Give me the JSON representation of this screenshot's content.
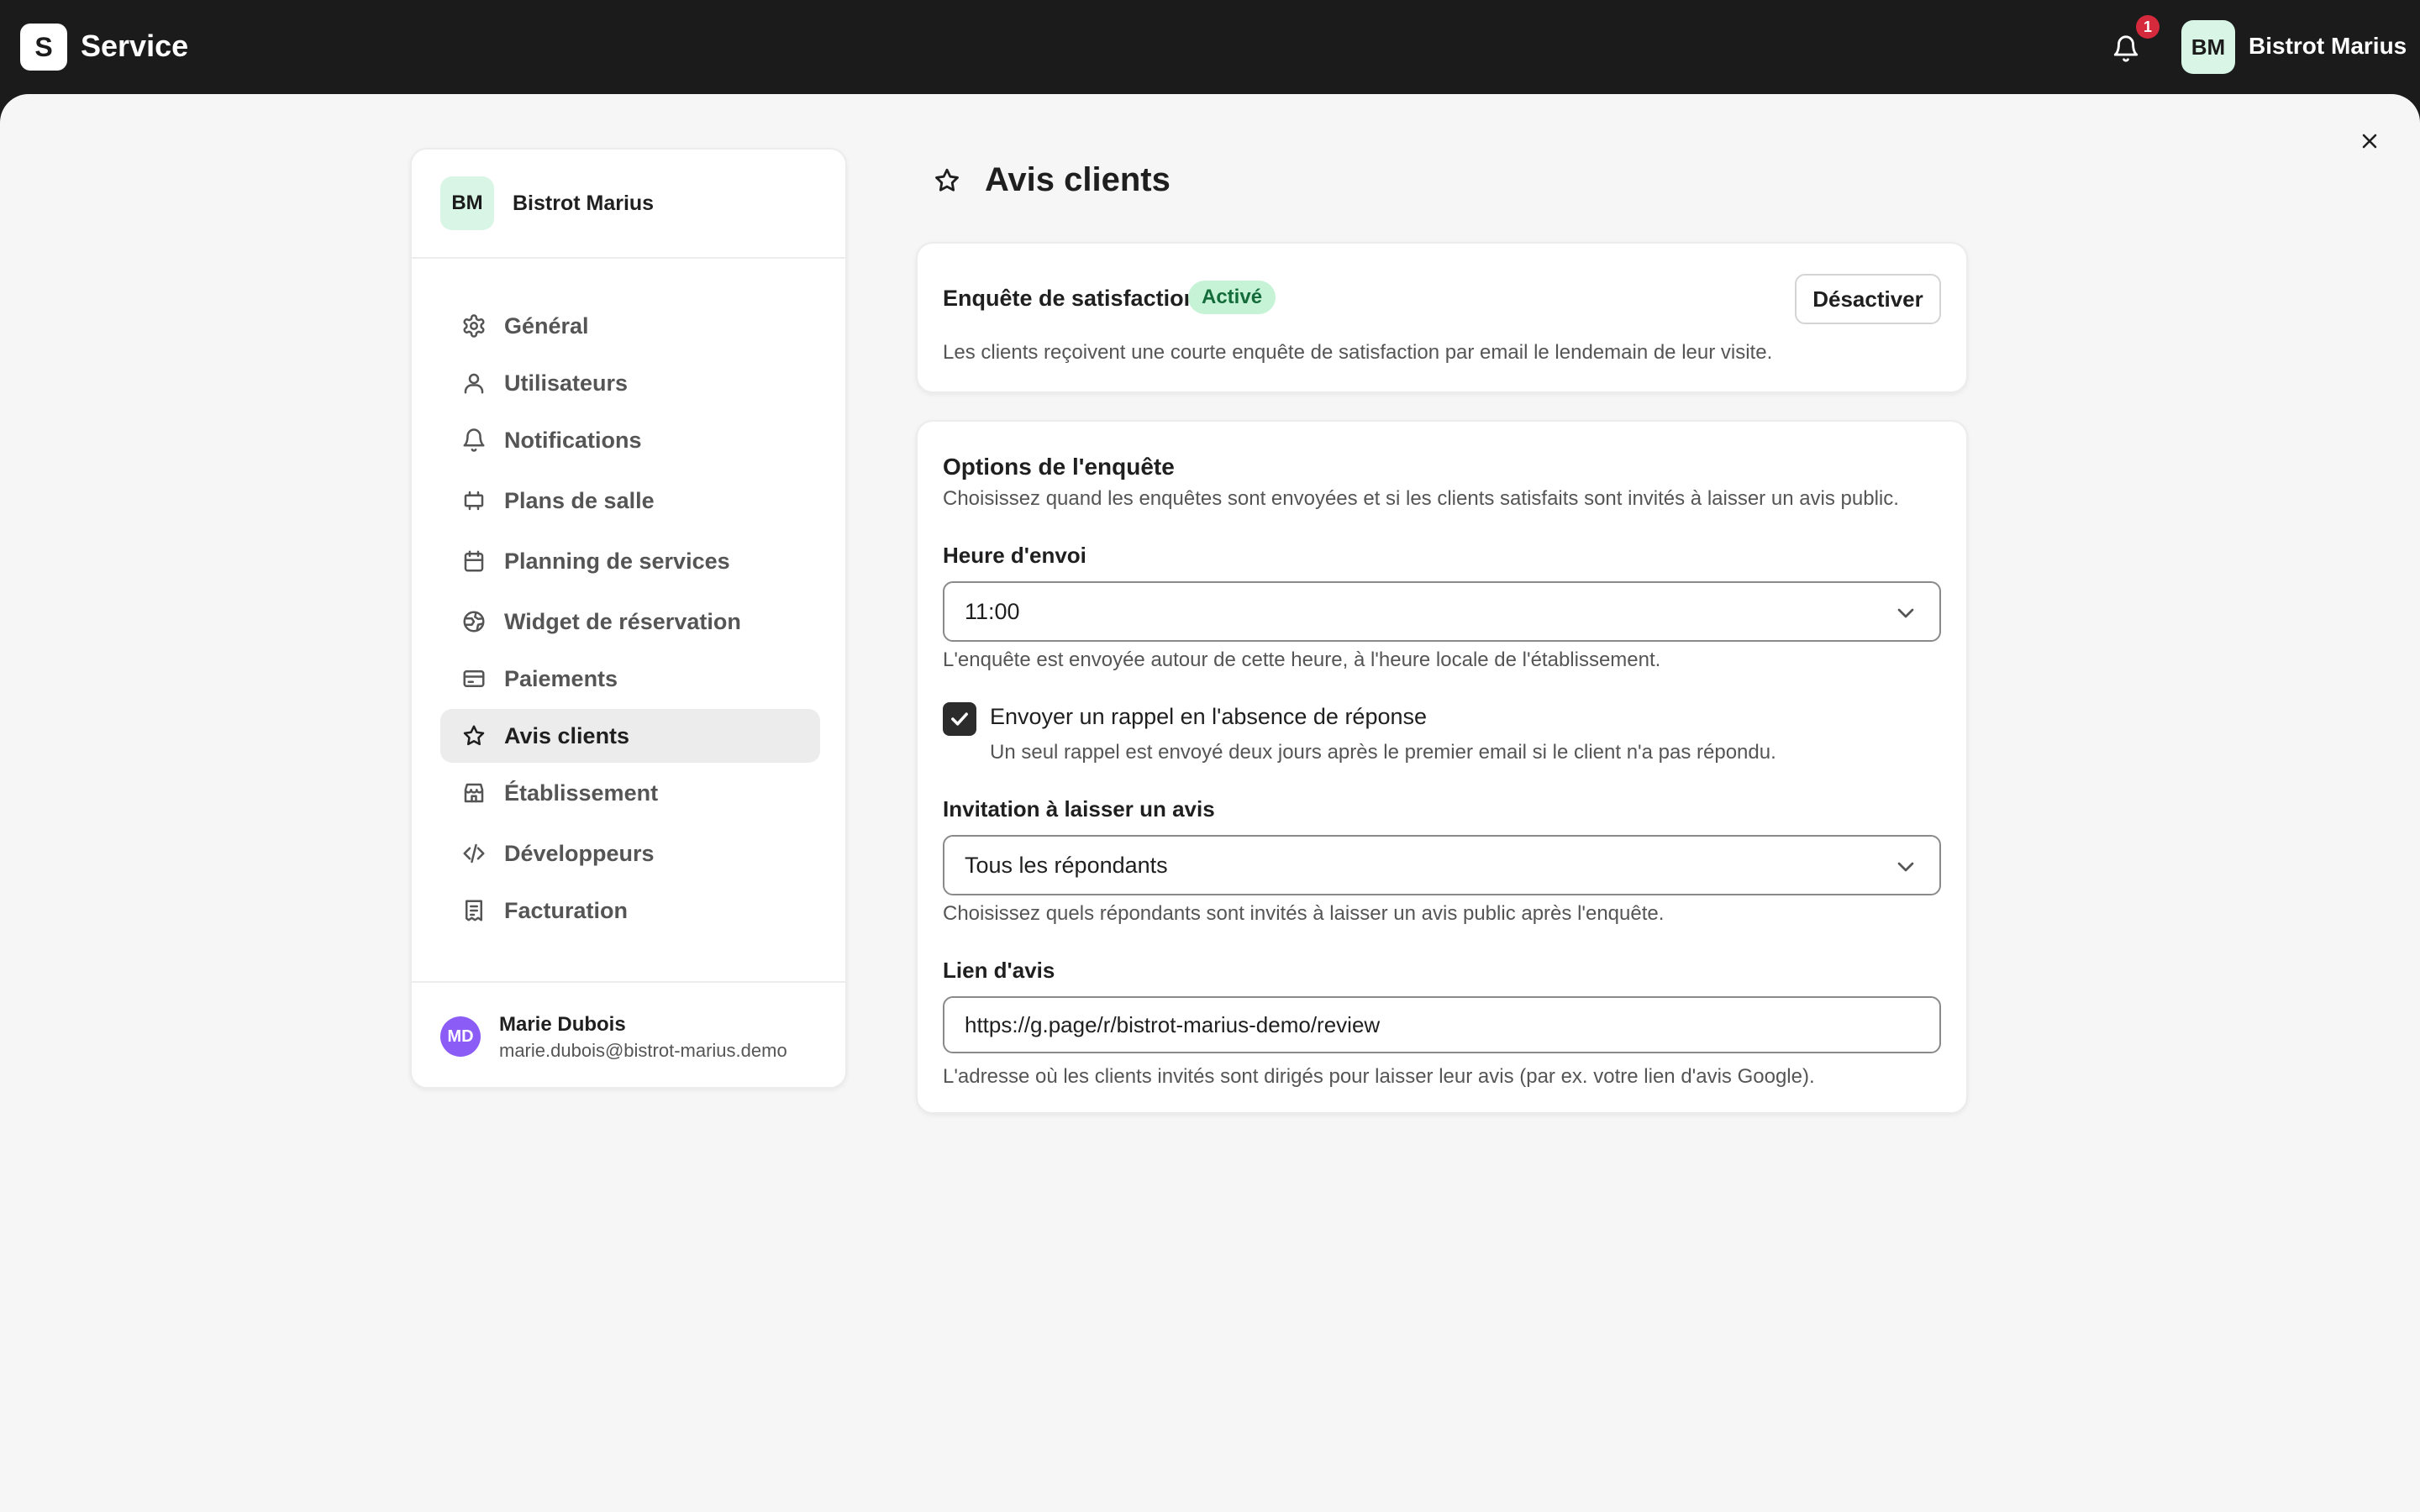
{
  "topbar": {
    "logo_letter": "S",
    "app_name": "Service",
    "notification_count": "1",
    "avatar_initials": "BM",
    "user_name": "Bistrot Marius"
  },
  "sidebar": {
    "org_initials": "BM",
    "org_name": "Bistrot Marius",
    "items": [
      {
        "label": "Général",
        "icon": "gear-icon"
      },
      {
        "label": "Utilisateurs",
        "icon": "user-icon"
      },
      {
        "label": "Notifications",
        "icon": "bell-icon"
      },
      {
        "label": "Plans de salle",
        "icon": "floor-plan-icon"
      },
      {
        "label": "Planning de services",
        "icon": "calendar-icon"
      },
      {
        "label": "Widget de réservation",
        "icon": "globe-icon"
      },
      {
        "label": "Paiements",
        "icon": "credit-card-icon"
      },
      {
        "label": "Avis clients",
        "icon": "star-icon"
      },
      {
        "label": "Établissement",
        "icon": "store-icon"
      },
      {
        "label": "Développeurs",
        "icon": "code-icon"
      },
      {
        "label": "Facturation",
        "icon": "receipt-icon"
      }
    ],
    "active_item": "Avis clients",
    "footer": {
      "initials": "MD",
      "name": "Marie Dubois",
      "email": "marie.dubois@bistrot-marius.demo"
    }
  },
  "page": {
    "title": "Avis clients"
  },
  "survey_card": {
    "title": "Enquête de satisfaction",
    "status": "Activé",
    "action_label": "Désactiver",
    "description": "Les clients reçoivent une courte enquête de satisfaction par email le lendemain de leur visite."
  },
  "options_card": {
    "title": "Options de l'enquête",
    "description": "Choisissez quand les enquêtes sont envoyées et si les clients satisfaits sont invités à laisser un avis public.",
    "send_time": {
      "label": "Heure d'envoi",
      "value": "11:00",
      "hint": "L'enquête est envoyée autour de cette heure, à l'heure locale de l'établissement."
    },
    "reminder": {
      "checked": true,
      "label": "Envoyer un rappel en l'absence de réponse",
      "hint": "Un seul rappel est envoyé deux jours après le premier email si le client n'a pas répondu."
    },
    "invitation": {
      "label": "Invitation à laisser un avis",
      "value": "Tous les répondants",
      "hint": "Choisissez quels répondants sont invités à laisser un avis public après l'enquête."
    },
    "review_link": {
      "label": "Lien d'avis",
      "value": "https://g.page/r/bistrot-marius-demo/review",
      "hint": "L'adresse où les clients invités sont dirigés pour laisser leur avis (par ex. votre lien d'avis Google)."
    }
  },
  "colors": {
    "topbar": "#1b1b1b",
    "background": "#f6f6f6",
    "active_badge_bg": "#c6f3d6",
    "active_badge_text": "#146c3b",
    "notification_badge": "#d42a3c",
    "footer_avatar": "#8b5cf6"
  }
}
